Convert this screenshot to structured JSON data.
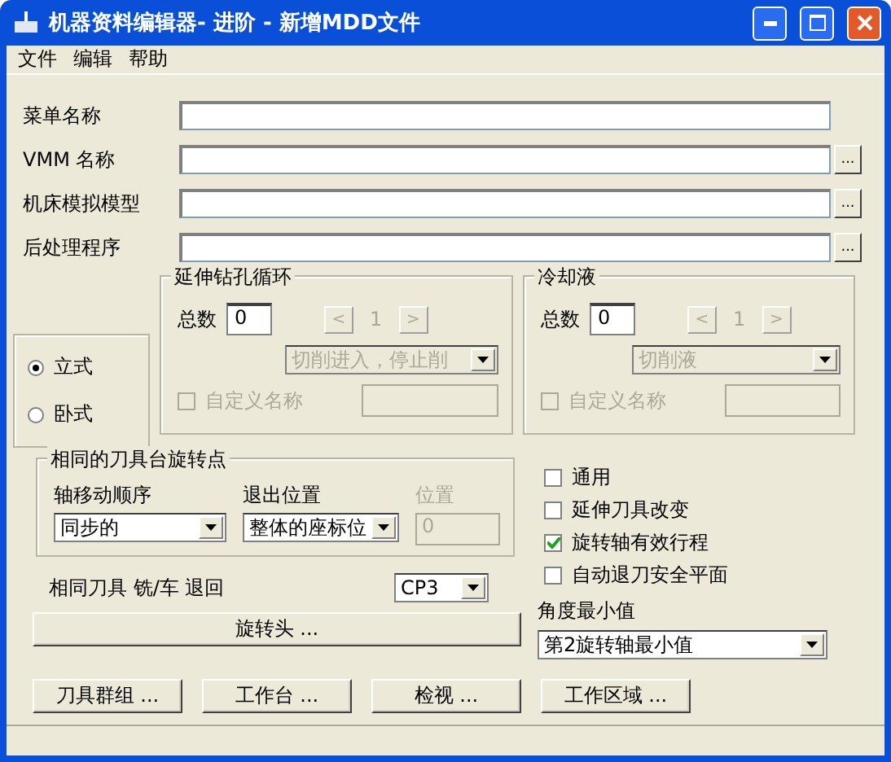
{
  "window": {
    "title": "机器资料编辑器-  进阶  -  新增MDD文件"
  },
  "menu": [
    "文件",
    "编辑",
    "帮助"
  ],
  "fields": [
    {
      "label": "菜单名称"
    },
    {
      "label": "VMM 名称",
      "browse": "..."
    },
    {
      "label": "机床模拟模型",
      "browse": "..."
    },
    {
      "label": "后处理程序",
      "browse": "..."
    }
  ],
  "orientation": [
    {
      "label": "立式",
      "selected": true
    },
    {
      "label": "卧式",
      "selected": false
    }
  ],
  "drill_cycle": {
    "title": "延伸钻孔循环",
    "count_label": "总数",
    "count": "0",
    "prev": "<",
    "page": "1",
    "next": ">",
    "select": "切削进入，停止削",
    "disabled": true,
    "custom_name": {
      "label": "自定义名称",
      "checked": false,
      "disabled": true
    }
  },
  "coolant": {
    "title": "冷却液",
    "count_label": "总数",
    "count": "0",
    "prev": "<",
    "page": "1",
    "next": ">",
    "select": "切削液",
    "disabled": true,
    "custom_name": {
      "label": "自定义名称",
      "checked": false,
      "disabled": true
    }
  },
  "tool_group": {
    "title": "相同的刀具台旋转点",
    "columns": [
      {
        "kind": "dropdown",
        "label": "轴移动顺序",
        "value": "同步的",
        "disabled": false
      },
      {
        "kind": "dropdown",
        "label": "退出位置",
        "value": "整体的座标位",
        "disabled": false
      },
      {
        "kind": "field",
        "label": "位置",
        "value": "0",
        "disabled": true
      }
    ]
  },
  "retract": {
    "label": "相同刀具 铣/车 退回",
    "value": "CP3"
  },
  "options": [
    {
      "label": "通用",
      "checked": false
    },
    {
      "label": "延伸刀具改变",
      "checked": false
    },
    {
      "label": "旋转轴有效行程",
      "checked": true
    },
    {
      "label": "自动退刀安全平面",
      "checked": false
    }
  ],
  "angle_min": {
    "label": "角度最小值",
    "value": "第2旋转轴最小值"
  },
  "rotary_button": "旋转头 ...",
  "buttons": [
    "刀具群组 ...",
    "工作台 ...",
    "检视 ...",
    "工作区域 ..."
  ]
}
